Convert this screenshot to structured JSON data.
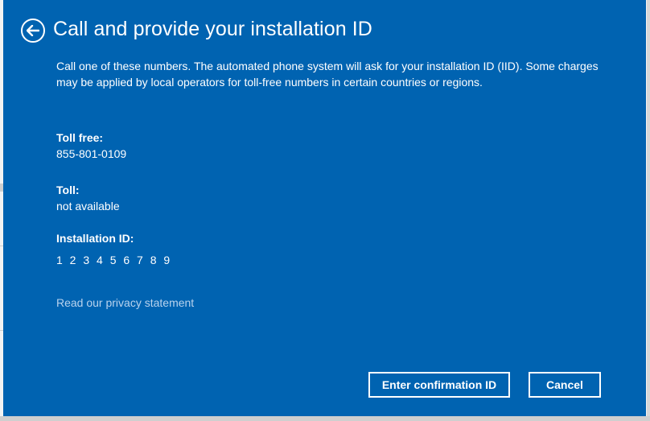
{
  "dialog": {
    "title": "Call and provide your installation ID",
    "description": "Call one of these numbers. The automated phone system will ask for your installation ID (IID). Some charges may be applied by local operators for toll-free numbers in certain countries or regions.",
    "toll_free": {
      "label": "Toll free:",
      "value": "855-801-0109"
    },
    "toll": {
      "label": "Toll:",
      "value": "not available"
    },
    "installation_id": {
      "label": "Installation ID:",
      "value": "1 2 3 4 5 6 7 8 9"
    },
    "privacy_link": "Read our privacy statement",
    "buttons": {
      "confirm": "Enter confirmation ID",
      "cancel": "Cancel"
    }
  },
  "colors": {
    "background": "#0063b1",
    "text": "#ffffff",
    "link": "#b9d3ee"
  },
  "icons": {
    "back": "back-arrow-circle-icon"
  }
}
